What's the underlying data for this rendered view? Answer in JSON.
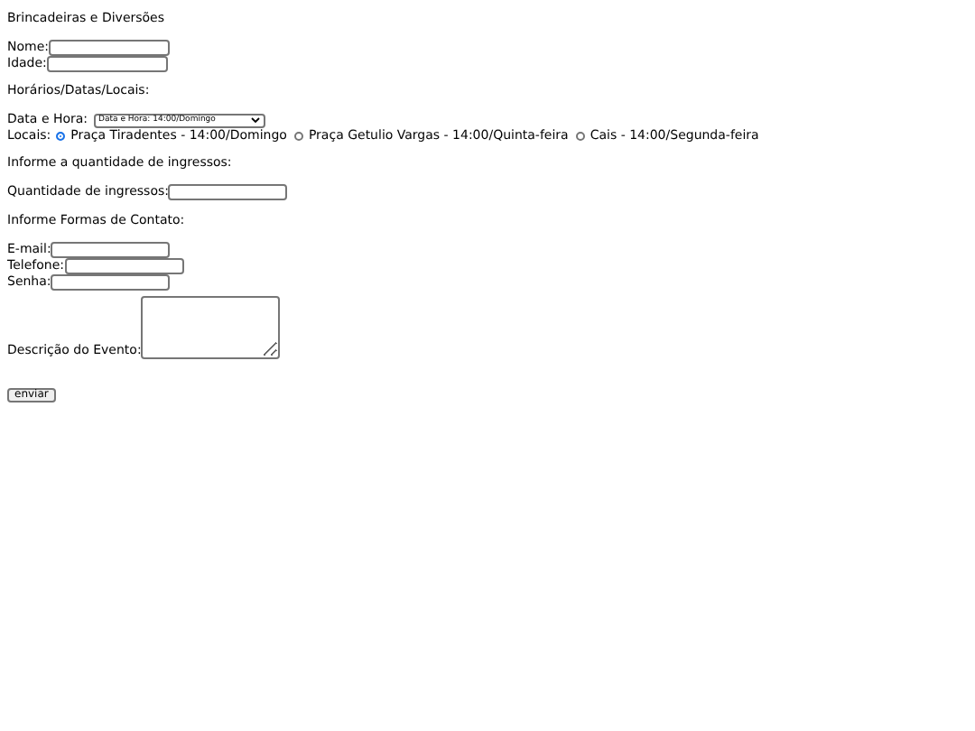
{
  "title": "Brincadeiras e Diversões",
  "personal_fields": [
    {
      "label": "Nome:"
    },
    {
      "label": "Idade:"
    }
  ],
  "schedule_heading": "Horários/Datas/Locais:",
  "datetime": {
    "label": "Data e Hora:",
    "value": "Data e Hora: 14:00/Domingo"
  },
  "locations": {
    "label": "Locais:",
    "options": [
      {
        "label": "Praça Tiradentes - 14:00/Domingo",
        "selected": true
      },
      {
        "label": "Praça Getulio Vargas - 14:00/Quinta-feira",
        "selected": false
      },
      {
        "label": "Cais - 14:00/Segunda-feira",
        "selected": false
      }
    ]
  },
  "tickets_heading": "Informe a quantidade de ingressos:",
  "tickets_field": {
    "label": "Quantidade de ingressos:"
  },
  "contact_heading": "Informe Formas de Contato:",
  "contact_fields": [
    {
      "label": "E-mail:"
    },
    {
      "label": "Telefone:"
    },
    {
      "label": "Senha:"
    }
  ],
  "description": {
    "label": "Descrição do Evento:"
  },
  "submit": "enviar"
}
